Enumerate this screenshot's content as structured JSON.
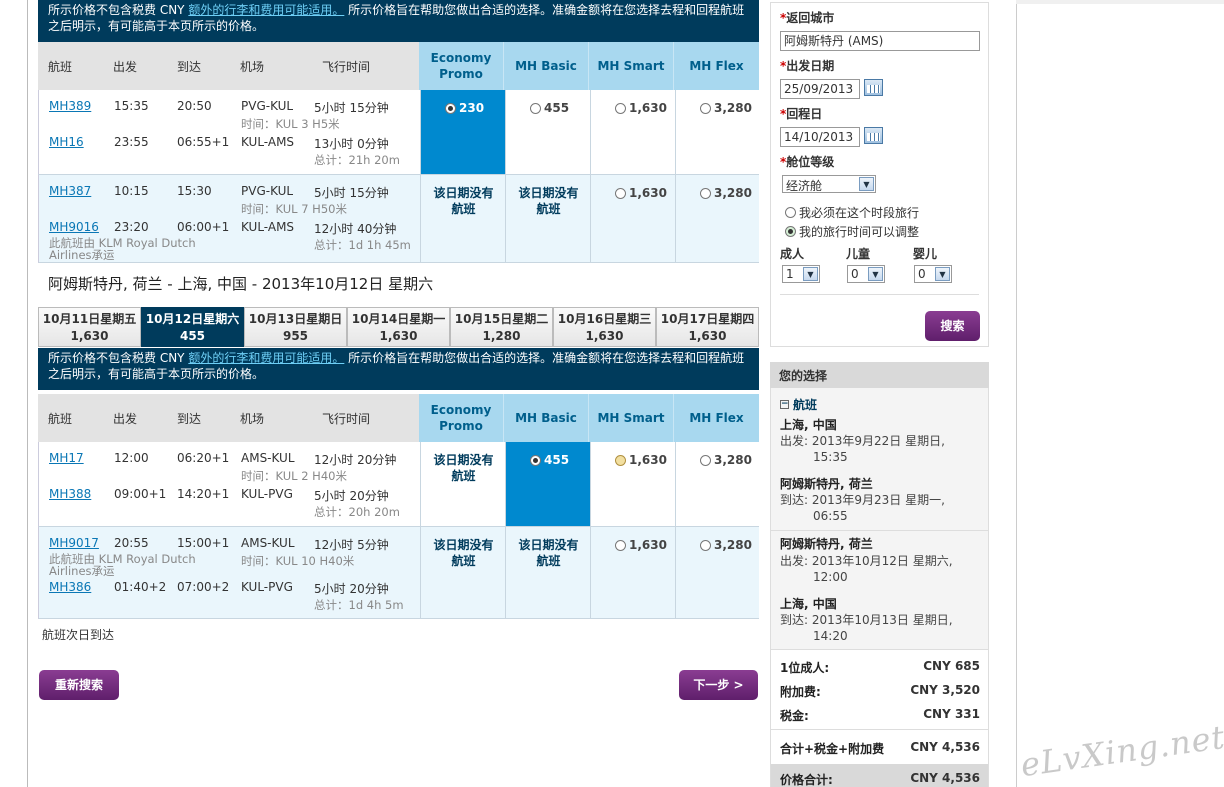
{
  "notice": {
    "prefix": "所示价格不包含税费 CNY ",
    "link": "额外的行李和费用可能适用。",
    "line1_rest": " 所示价格旨在帮助您做出合适的选择。准确金额将在您选择去程和回程航班",
    "line2": "之后明示，有可能高于本页所示的价格。"
  },
  "columns": {
    "flight": "航班",
    "depart": "出发",
    "arrive": "到达",
    "airport": "机场",
    "duration": "飞行时间",
    "fares": [
      "Economy\nPromo",
      "MH Basic",
      "MH Smart",
      "MH Flex"
    ]
  },
  "outbound": {
    "groups": [
      {
        "legs": [
          {
            "flight": "MH389",
            "dep": "15:35",
            "arr": "20:50",
            "route": "PVG-KUL",
            "dur": "5小时 15分钟",
            "note": "时间：KUL 3 H5米"
          },
          {
            "flight": "MH16",
            "dep": "23:55",
            "arr": "06:55+1",
            "route": "KUL-AMS",
            "dur": "13小时 0分钟",
            "note": "总计：21h 20m"
          }
        ],
        "fares": [
          {
            "kind": "price",
            "value": "230",
            "selected": true
          },
          {
            "kind": "price",
            "value": "455"
          },
          {
            "kind": "price",
            "value": "1,630"
          },
          {
            "kind": "price",
            "value": "3,280"
          }
        ]
      },
      {
        "legs": [
          {
            "flight": "MH387",
            "dep": "10:15",
            "arr": "15:30",
            "route": "PVG-KUL",
            "dur": "5小时 15分钟",
            "note": "时间：KUL 7 H50米"
          },
          {
            "flight": "MH9016",
            "dep": "23:20",
            "arr": "06:00+1",
            "route": "KUL-AMS",
            "dur": "12小时 40分钟",
            "note": "总计：1d 1h 45m",
            "operated": "此航班由 KLM Royal Dutch Airlines承运"
          }
        ],
        "fares": [
          {
            "kind": "none",
            "value": "该日期没有航班"
          },
          {
            "kind": "none",
            "value": "该日期没有航班"
          },
          {
            "kind": "price",
            "value": "1,630"
          },
          {
            "kind": "price",
            "value": "3,280"
          }
        ]
      }
    ]
  },
  "return_title": "阿姆斯特丹, 荷兰 - 上海, 中国 - 2013年10月12日 星期六",
  "date_tabs": [
    {
      "date": "10月11日星期五",
      "price": "1,630"
    },
    {
      "date": "10月12日星期六",
      "price": "455",
      "active": true
    },
    {
      "date": "10月13日星期日",
      "price": "955"
    },
    {
      "date": "10月14日星期一",
      "price": "1,630"
    },
    {
      "date": "10月15日星期二",
      "price": "1,280"
    },
    {
      "date": "10月16日星期三",
      "price": "1,630"
    },
    {
      "date": "10月17日星期四",
      "price": "1,630"
    }
  ],
  "inbound": {
    "groups": [
      {
        "legs": [
          {
            "flight": "MH17",
            "dep": "12:00",
            "arr": "06:20+1",
            "route": "AMS-KUL",
            "dur": "12小时 20分钟",
            "note": "时间：KUL 2 H40米"
          },
          {
            "flight": "MH388",
            "dep": "09:00+1",
            "arr": "14:20+1",
            "route": "KUL-PVG",
            "dur": "5小时 20分钟",
            "note": "总计：20h 20m"
          }
        ],
        "fares": [
          {
            "kind": "none",
            "value": "该日期没有航班"
          },
          {
            "kind": "price",
            "value": "455",
            "selected": true
          },
          {
            "kind": "price",
            "value": "1,630",
            "gold": true
          },
          {
            "kind": "price",
            "value": "3,280"
          }
        ]
      },
      {
        "legs": [
          {
            "flight": "MH9017",
            "dep": "20:55",
            "arr": "15:00+1",
            "route": "AMS-KUL",
            "dur": "12小时 5分钟",
            "note": "时间：KUL 10 H40米",
            "operated": "此航班由 KLM Royal Dutch Airlines承运"
          },
          {
            "flight": "MH386",
            "dep": "01:40+2",
            "arr": "07:00+2",
            "route": "KUL-PVG",
            "dur": "5小时 20分钟",
            "note": "总计：1d 4h 5m"
          }
        ],
        "fares": [
          {
            "kind": "none",
            "value": "该日期没有航班"
          },
          {
            "kind": "none",
            "value": "该日期没有航班"
          },
          {
            "kind": "price",
            "value": "1,630"
          },
          {
            "kind": "price",
            "value": "3,280"
          }
        ]
      }
    ]
  },
  "next_day_note": "航班次日到达",
  "buttons": {
    "research": "重新搜索",
    "next": "下一步 >"
  },
  "search": {
    "return_city_label": "返回城市",
    "return_city": "阿姆斯特丹 (AMS)",
    "depart_label": "出发日期",
    "depart_date": "25/09/2013",
    "return_label": "回程日",
    "return_date": "14/10/2013",
    "cabin_label": "舱位等级",
    "cabin": "经济舱",
    "opt_fixed": "我必须在这个时段旅行",
    "opt_flex": "我的旅行时间可以调整",
    "adults_label": "成人",
    "adults": "1",
    "children_label": "儿童",
    "children": "0",
    "infants_label": "婴儿",
    "infants": "0",
    "search_btn": "搜索"
  },
  "summary": {
    "title": "您的选择",
    "section": "航班",
    "segments": [
      {
        "city": "上海, 中国",
        "line1": "出发: 2013年9月22日 星期日,",
        "line2": "15:35"
      },
      {
        "city": "阿姆斯特丹, 荷兰",
        "line1": "到达: 2013年9月23日 星期一,",
        "line2": "06:55"
      },
      {
        "city": "阿姆斯特丹, 荷兰",
        "line1": "出发: 2013年10月12日 星期六,",
        "line2": "12:00"
      },
      {
        "city": "上海, 中国",
        "line1": "到达: 2013年10月13日 星期日,",
        "line2": "14:20"
      }
    ],
    "costs": [
      {
        "label": "1位成人:",
        "value": "CNY 685"
      },
      {
        "label": "附加费:",
        "value": "CNY 3,520"
      },
      {
        "label": "税金:",
        "value": "CNY 331"
      }
    ],
    "subtotal_label": "合计+税金+附加费",
    "subtotal": "CNY 4,536",
    "total_label": "价格合计:",
    "total": "CNY 4,536"
  },
  "watermark": "eLvXing.net"
}
